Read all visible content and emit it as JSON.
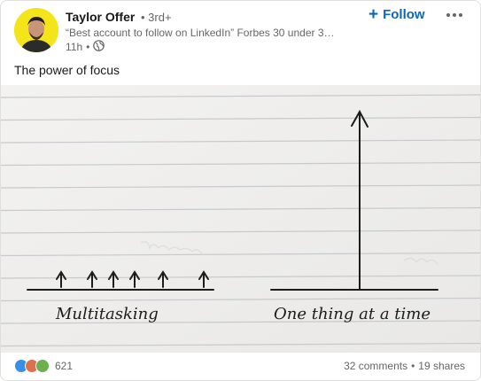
{
  "post": {
    "author_name": "Taylor Offer",
    "connection_degree": "3rd+",
    "headline": "“Best account to follow on LinkedIn” Forbes 30 under 3…",
    "time_ago": "11h",
    "follow_label": "Follow",
    "text": "The power of focus",
    "image_labels": {
      "left": "Multitasking",
      "right": "One thing at a time"
    }
  },
  "social": {
    "reaction_count": "621",
    "comments": "32 comments",
    "shares": "19 shares",
    "separator": "•"
  },
  "icons": [
    "globe-icon",
    "more-icon",
    "like-reaction-icon",
    "love-reaction-icon",
    "support-reaction-icon"
  ],
  "colors": {
    "accent": "#0a66c2",
    "avatar_bg": "#f3e51a",
    "paper": "#f1f0ee",
    "rule_line": "#c7c9cc"
  }
}
